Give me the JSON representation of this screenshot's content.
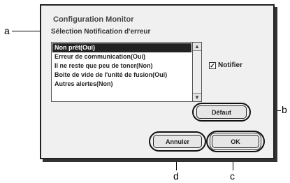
{
  "dialog": {
    "title": "Configuration Monitor",
    "section_label": "Sélection Notification d'erreur",
    "list_items": [
      "Non prêt(Oui)",
      "Erreur de communication(Oui)",
      "Il ne reste que peu de toner(Non)",
      "Boite de vide de l'unité de fusion(Oui)",
      "Autres alertes(Non)"
    ],
    "selected_index": 0,
    "notify_checkbox": {
      "label": "Notifier",
      "checked": true
    },
    "buttons": {
      "default": "Défaut",
      "cancel": "Annuler",
      "ok": "OK"
    }
  },
  "callouts": {
    "a": "a",
    "b": "b",
    "c": "c",
    "d": "d"
  },
  "icons": {
    "scroll_up": "triangle-up-icon",
    "scroll_down": "triangle-down-icon",
    "check": "checkmark-icon"
  }
}
